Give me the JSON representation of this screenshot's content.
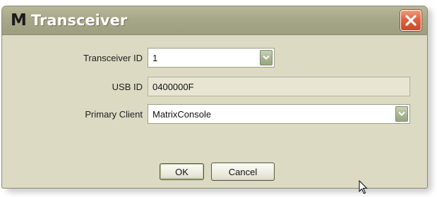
{
  "window": {
    "title_logo": "M",
    "title": "Transceiver"
  },
  "form": {
    "transceiver_id": {
      "label": "Transceiver ID",
      "value": "1"
    },
    "usb_id": {
      "label": "USB ID",
      "value": "0400000F"
    },
    "primary_client": {
      "label": "Primary Client",
      "value": "MatrixConsole"
    }
  },
  "buttons": {
    "ok": "OK",
    "cancel": "Cancel"
  },
  "icons": {
    "close": "close-icon",
    "dropdown": "chevron-down-icon",
    "cursor": "mouse-pointer-icon"
  },
  "colors": {
    "titlebar": "#a7a789",
    "window_bg": "#dcdac3",
    "close_button": "#e0623f"
  }
}
